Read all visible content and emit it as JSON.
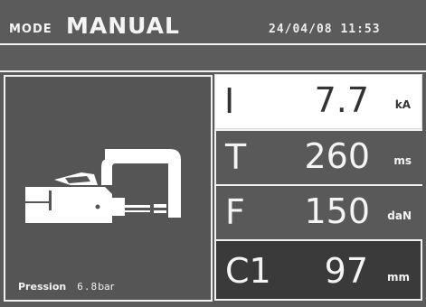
{
  "header": {
    "mode_label": "MODE",
    "mode_value": "MANUAL",
    "datetime": "24/04/08 11:53"
  },
  "left_panel": {
    "illustration_icon": "welding-gun-icon",
    "pression_label": "Pression",
    "pression_value": "6.8",
    "pression_unit": "bar"
  },
  "parameters": [
    {
      "symbol": "I",
      "value": "7.7",
      "unit": "kA",
      "selected": true
    },
    {
      "symbol": "T",
      "value": "260",
      "unit": "ms",
      "selected": false
    },
    {
      "symbol": "F",
      "value": "150",
      "unit": "daN",
      "selected": false
    },
    {
      "symbol": "C1",
      "value": "97",
      "unit": "mm",
      "selected": false
    }
  ],
  "colors": {
    "background": "#5a5a5a",
    "selected_row": "#ffffff",
    "text": "#f4f4f4",
    "dark_row": "#3a3a3a"
  }
}
